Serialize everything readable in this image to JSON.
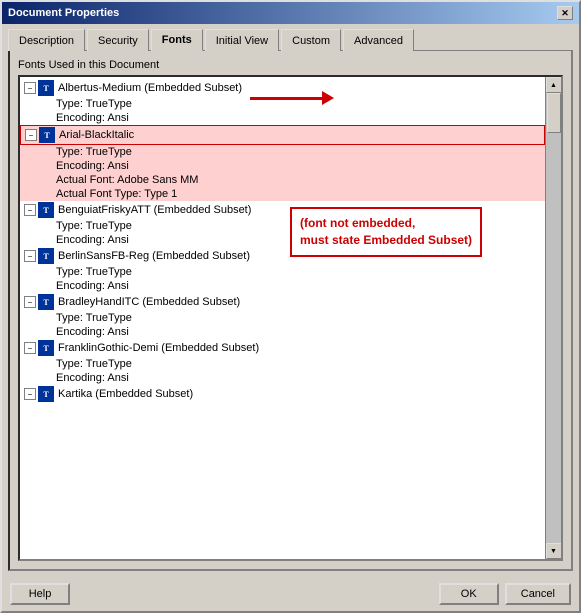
{
  "window": {
    "title": "Document Properties",
    "close_label": "✕"
  },
  "tabs": [
    {
      "id": "description",
      "label": "Description",
      "active": false
    },
    {
      "id": "security",
      "label": "Security",
      "active": false
    },
    {
      "id": "fonts",
      "label": "Fonts",
      "active": true
    },
    {
      "id": "initial-view",
      "label": "Initial View",
      "active": false
    },
    {
      "id": "custom",
      "label": "Custom",
      "active": false
    },
    {
      "id": "advanced",
      "label": "Advanced",
      "active": false
    }
  ],
  "section": {
    "label": "Fonts Used in this Document"
  },
  "fonts": [
    {
      "name": "Albertus-Medium (Embedded Subset)",
      "details": [
        "Type: TrueType",
        "Encoding: Ansi"
      ],
      "highlighted": false
    },
    {
      "name": "Arial-BlackItalic",
      "details": [
        "Type: TrueType",
        "Encoding: Ansi",
        "Actual Font: Adobe Sans MM",
        "Actual Font Type: Type 1"
      ],
      "highlighted": true
    },
    {
      "name": "BenguiatFriskyATT (Embedded Subset)",
      "details": [
        "Type: TrueType",
        "Encoding: Ansi"
      ],
      "highlighted": false
    },
    {
      "name": "BerlinSansFB-Reg (Embedded Subset)",
      "details": [
        "Type: TrueType",
        "Encoding: Ansi"
      ],
      "highlighted": false
    },
    {
      "name": "BradleyHandITC (Embedded Subset)",
      "details": [
        "Type: TrueType",
        "Encoding: Ansi"
      ],
      "highlighted": false
    },
    {
      "name": "FranklinGothic-Demi (Embedded Subset)",
      "details": [
        "Type: TrueType",
        "Encoding: Ansi"
      ],
      "highlighted": false
    },
    {
      "name": "Kartika (Embedded Subset)",
      "details": [],
      "highlighted": false
    }
  ],
  "annotation": {
    "text_line1": "(font not embedded,",
    "text_line2": "must state Embedded Subset)"
  },
  "buttons": {
    "help": "Help",
    "ok": "OK",
    "cancel": "Cancel"
  }
}
